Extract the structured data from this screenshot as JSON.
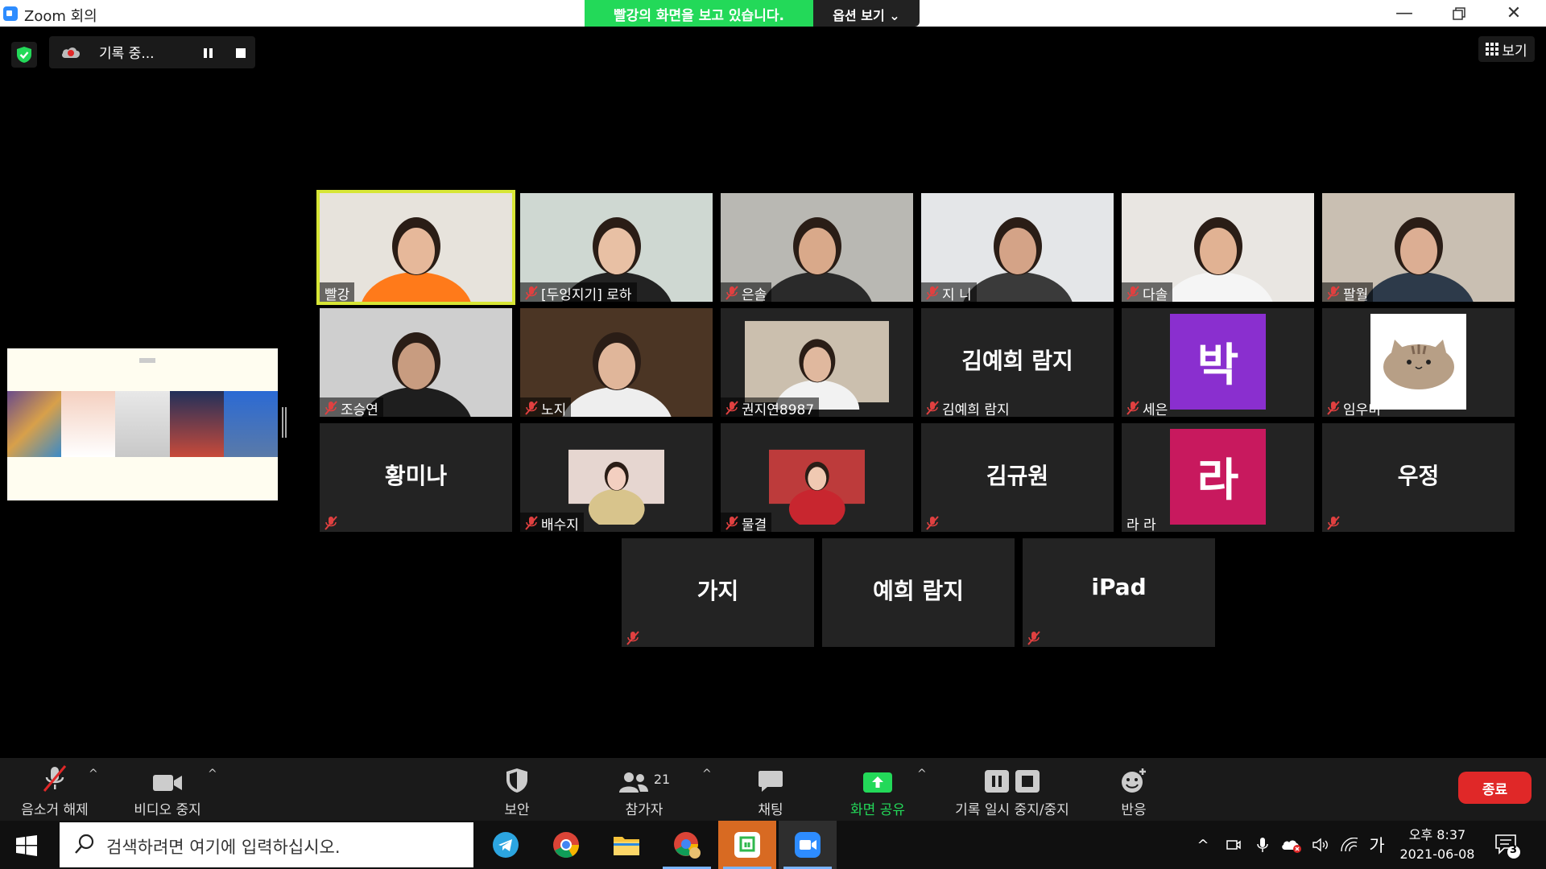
{
  "window": {
    "title": "Zoom 회의",
    "banner_viewing": "빨강의 화면을 보고 있습니다.",
    "banner_options": "옵션 보기 ⌄"
  },
  "topbar": {
    "recording_text": "기록 중...",
    "view_label": "보기"
  },
  "participants": [
    {
      "name": "빨강",
      "muted": false,
      "active": true,
      "type": "video",
      "bg": "#e7e3dc",
      "skin": "#e6b89a",
      "shirt": "#ff7a1a"
    },
    {
      "name": "[두잉지기] 로하",
      "muted": true,
      "type": "video",
      "bg": "#cfd8d2",
      "skin": "#e8c0a4",
      "shirt": "#222222"
    },
    {
      "name": "은솔",
      "muted": true,
      "type": "video",
      "bg": "#b9b8b3",
      "skin": "#d9a98a",
      "shirt": "#2a2a2a"
    },
    {
      "name": "지 니",
      "muted": true,
      "type": "video",
      "bg": "#e4e6e8",
      "skin": "#d4a387",
      "shirt": "#3a3a3a"
    },
    {
      "name": "다솔",
      "muted": true,
      "type": "video",
      "bg": "#e9e6e2",
      "skin": "#e1b293",
      "shirt": "#f5f5f5"
    },
    {
      "name": "팔월",
      "muted": true,
      "type": "video",
      "bg": "#c9bfb2",
      "skin": "#dcae93",
      "shirt": "#2d3a4a"
    },
    {
      "name": "조승연",
      "muted": true,
      "type": "video",
      "bg": "#cfcfcf",
      "skin": "#c89c80",
      "shirt": "#1e1e1e"
    },
    {
      "name": "노지",
      "muted": true,
      "type": "video",
      "bg": "#4b3524",
      "skin": "#e0b69a",
      "shirt": "#eeeeee"
    },
    {
      "name": "권지연8987",
      "muted": true,
      "type": "photo",
      "bg": "#cbbfae",
      "skin": "#e0b89e",
      "shirt": "#f2f2f2"
    },
    {
      "name": "김예희 람지",
      "muted": true,
      "type": "name"
    },
    {
      "name": "세은",
      "muted": true,
      "type": "avatar",
      "letter": "박",
      "color": "#8a2fcf"
    },
    {
      "name": "임우미",
      "muted": true,
      "type": "pusheen"
    },
    {
      "name": "황미나",
      "muted": true,
      "type": "name",
      "label_hidden": true
    },
    {
      "name": "배수지",
      "muted": true,
      "type": "photo",
      "bg": "#e6d6d0",
      "skin": "#f3cfc0",
      "shirt": "#d8c48c"
    },
    {
      "name": "물결",
      "muted": true,
      "type": "photo",
      "bg": "#bd3b3b",
      "skin": "#f0c9b2",
      "shirt": "#c8262f"
    },
    {
      "name": "김규원",
      "muted": true,
      "type": "name",
      "label_hidden": true
    },
    {
      "name": "라 라",
      "muted": false,
      "type": "avatar",
      "letter": "라",
      "color": "#c8195e"
    },
    {
      "name": "우정",
      "muted": true,
      "type": "name",
      "label_hidden": true
    },
    {
      "name": "가지",
      "muted": true,
      "type": "name",
      "label_hidden": true
    },
    {
      "name": "예희 람지",
      "muted": false,
      "type": "name",
      "label_hidden": true
    },
    {
      "name": "iPad",
      "muted": true,
      "type": "name",
      "label_hidden": true
    }
  ],
  "toolbar": {
    "unmute": "음소거 해제",
    "stop_video": "비디오 중지",
    "security": "보안",
    "participants": "참가자",
    "participants_count": "21",
    "chat": "채팅",
    "share_screen": "화면 공유",
    "pause_stop_recording": "기록 일시 중지/중지",
    "reactions": "반응",
    "end": "종료"
  },
  "taskbar": {
    "search_placeholder": "검색하려면 여기에 입력하십시오.",
    "ime": "가",
    "time": "오후 8:37",
    "date": "2021-06-08",
    "notifications_count": "3"
  },
  "colors": {
    "accent_green": "#23d959",
    "active_speaker": "#d7e636",
    "end_red": "#e02828"
  }
}
